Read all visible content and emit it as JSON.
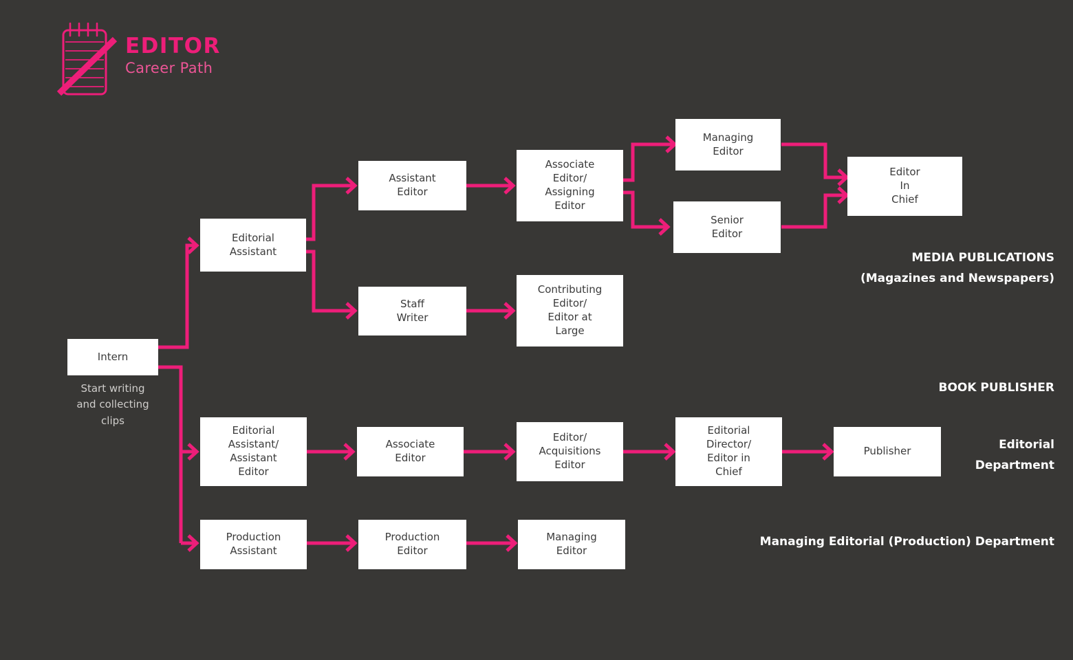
{
  "logo": {
    "icon": "notepad-pencil-icon",
    "title": "EDITOR",
    "subtitle": "Career Path",
    "color": "#ED1E79",
    "subtitle_color": "#ED5596"
  },
  "theme": {
    "background": "#383735",
    "accent_pink": "#ED1E79",
    "node_fill": "#FFFFFF",
    "node_text": "#3B3B3B",
    "caption_text": "#CFCDCB",
    "section_text": "#FFFFFF"
  },
  "nodes": {
    "intern": "Intern",
    "intern_caption": "Start writing\nand collecting\nclips",
    "editorial_assistant": "Editorial\nAssistant",
    "assistant_editor": "Assistant\nEditor",
    "associate_assigning_editor": "Associate\nEditor/\nAssigning\nEditor",
    "managing_editor_media": "Managing\nEditor",
    "senior_editor": "Senior\nEditor",
    "editor_in_chief": "Editor\nIn\nChief",
    "staff_writer": "Staff\nWriter",
    "contributing_editor": "Contributing\nEditor/\nEditor at\nLarge",
    "editorial_assistant_book": "Editorial\nAssistant/\nAssistant\nEditor",
    "associate_editor_book": "Associate\nEditor",
    "editor_acquisitions": "Editor/\nAcquisitions\nEditor",
    "editorial_director": "Editorial\nDirector/\nEditor in\nChief",
    "publisher": "Publisher",
    "production_assistant": "Production\nAssistant",
    "production_editor": "Production\nEditor",
    "managing_editor_production": "Managing\nEditor"
  },
  "sections": {
    "media": "MEDIA PUBLICATIONS\n(Magazines and Newspapers)",
    "book_publisher": "BOOK PUBLISHER",
    "editorial_department": "Editorial\nDepartment",
    "production_department": "Managing Editorial (Production) Department"
  },
  "chart_data": {
    "type": "diagram",
    "title": "EDITOR Career Path",
    "flows": [
      {
        "from": "Intern",
        "to": "Editorial Assistant"
      },
      {
        "from": "Intern",
        "to": "Editorial Assistant/ Assistant Editor"
      },
      {
        "from": "Intern",
        "to": "Production Assistant"
      },
      {
        "from": "Editorial Assistant",
        "to": "Assistant Editor"
      },
      {
        "from": "Editorial Assistant",
        "to": "Staff Writer"
      },
      {
        "from": "Assistant Editor",
        "to": "Associate Editor/ Assigning Editor"
      },
      {
        "from": "Associate Editor/ Assigning Editor",
        "to": "Managing Editor"
      },
      {
        "from": "Associate Editor/ Assigning Editor",
        "to": "Senior Editor"
      },
      {
        "from": "Managing Editor",
        "to": "Editor In Chief"
      },
      {
        "from": "Senior Editor",
        "to": "Editor In Chief"
      },
      {
        "from": "Staff Writer",
        "to": "Contributing Editor/ Editor at Large"
      },
      {
        "from": "Editorial Assistant/ Assistant Editor",
        "to": "Associate Editor"
      },
      {
        "from": "Associate Editor",
        "to": "Editor/ Acquisitions Editor"
      },
      {
        "from": "Editor/ Acquisitions Editor",
        "to": "Editorial Director/ Editor in Chief"
      },
      {
        "from": "Editorial Director/ Editor in Chief",
        "to": "Publisher"
      },
      {
        "from": "Production Assistant",
        "to": "Production Editor"
      },
      {
        "from": "Production Editor",
        "to": "Managing Editor"
      }
    ]
  }
}
